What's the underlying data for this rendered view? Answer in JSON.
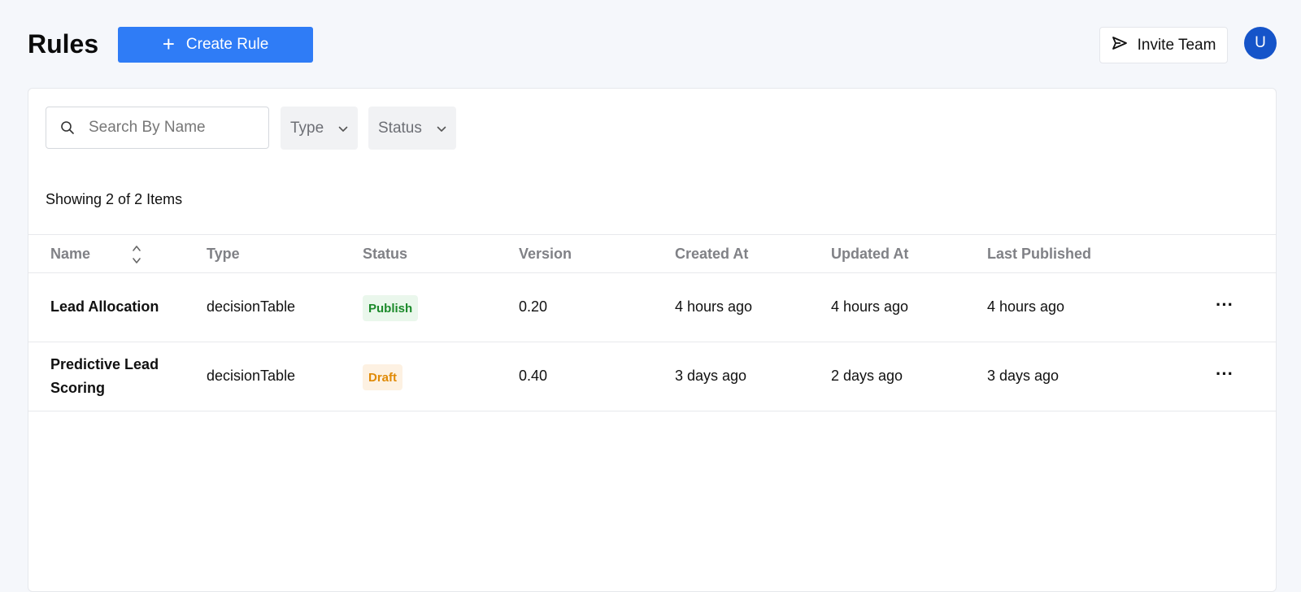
{
  "header": {
    "title": "Rules",
    "create_label": "Create Rule",
    "invite_label": "Invite Team",
    "avatar_initial": "U"
  },
  "filters": {
    "search_placeholder": "Search By Name",
    "type_label": "Type",
    "status_label": "Status"
  },
  "summary": "Showing 2 of 2 Items",
  "table": {
    "columns": [
      "Name",
      "Type",
      "Status",
      "Version",
      "Created At",
      "Updated At",
      "Last Published"
    ],
    "rows": [
      {
        "name": "Lead Allocation",
        "type": "decisionTable",
        "status": "Publish",
        "version": "0.20",
        "created": "4 hours ago",
        "updated": "4 hours ago",
        "published": "4 hours ago"
      },
      {
        "name": "Predictive Lead Scoring",
        "type": "decisionTable",
        "status": "Draft",
        "version": "0.40",
        "created": "3 days ago",
        "updated": "2 days ago",
        "published": "3 days ago"
      }
    ]
  },
  "colors": {
    "primary": "#2f7cf6",
    "avatar": "#1554c9",
    "publish_bg": "#eaf7ec",
    "publish_fg": "#1b8a2a",
    "draft_bg": "#fdf1e2",
    "draft_fg": "#e08a06"
  }
}
